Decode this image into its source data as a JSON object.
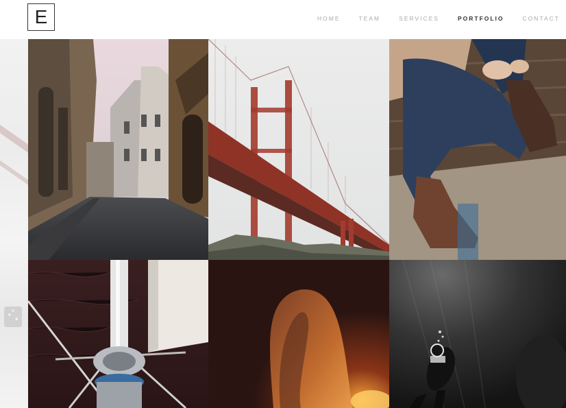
{
  "header": {
    "logo_letter": "E",
    "nav": [
      {
        "label": "HOME",
        "active": false
      },
      {
        "label": "TEAM",
        "active": false
      },
      {
        "label": "SERVICES",
        "active": false
      },
      {
        "label": "PORTFOLIO",
        "active": true
      },
      {
        "label": "CONTACT",
        "active": false
      }
    ]
  },
  "portfolio": {
    "items": [
      {
        "subject": "cobblestone street"
      },
      {
        "subject": "red suspension bridge in fog"
      },
      {
        "subject": "person in jeans and boots"
      },
      {
        "subject": "sailboat mast over water"
      },
      {
        "subject": "woman with long hair at sunset"
      },
      {
        "subject": "scuba diver underwater"
      }
    ]
  },
  "colors": {
    "nav_text": "#a9a9a9",
    "nav_active": "#333333",
    "background": "#ffffff"
  }
}
